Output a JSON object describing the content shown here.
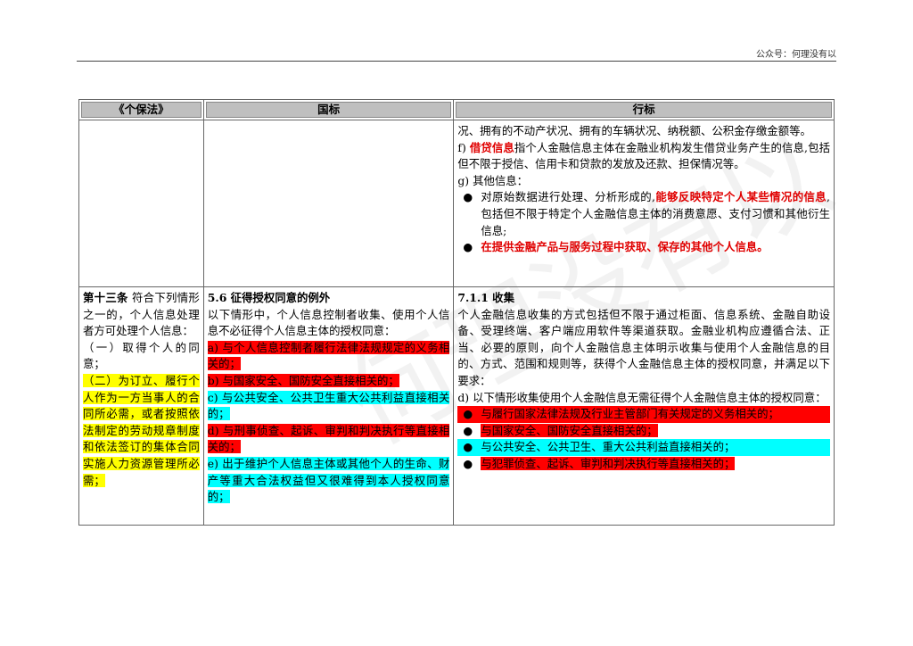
{
  "header": {
    "account": "公众号：何理没有以"
  },
  "watermark": "何理没有以",
  "table": {
    "headers": [
      "《个保法》",
      "国标",
      "行标"
    ],
    "row1": {
      "col3": {
        "cont": "况、拥有的不动产状况、拥有的车辆状况、纳税额、公积金存缴金额等。",
        "f_prefix": "f)",
        "f_term": "借贷信息",
        "f_text": "指个人金融信息主体在金融业机构发生借贷业务产生的信息,包括但不限于授信、信用卡和贷款的发放及还款、担保情况等。",
        "g": "g)  其他信息：",
        "b1_pre": "对原始数据进行处理、分析形成的,",
        "b1_red": "能够反映特定个人某些情况的信息",
        "b1_post": ",包括但不限于特定个人金融信息主体的消费意愿、支付习惯和其他衍生信息;",
        "b2_red": "在提供金融产品与服务过程中获取、保存的其他个人信息。"
      }
    },
    "row2": {
      "col1": {
        "bold": "第十三条",
        "text": " 符合下列情形之一的，个人信息处理者方可处理个人信息：",
        "item1": "（一）取得个人的同意；",
        "item2": "（二）为订立、履行个人作为一方当事人的合同所必需，或者按照依法制定的劳动规章制度和依法签订的集体合同实施人力资源管理所必需；"
      },
      "col2": {
        "title": "5.6  征得授权同意的例外",
        "intro": "以下情形中，个人信息控制者收集、使用个人信息不必征得个人信息主体的授权同意：",
        "a": "a) 与个人信息控制者履行法律法规规定的义务相关的；",
        "b": "b) 与国家安全、国防安全直接相关的；",
        "c": "c) 与公共安全、公共卫生重大公共利益直接相关的；",
        "d": "d) 与刑事侦查、起诉、审判和判决执行等直接相关的；",
        "e": "e) 出于维护个人信息主体或其他个人的生命、财产等重大合法权益但又很难得到本人授权同意的；"
      },
      "col3": {
        "title": "7.1.1  收集",
        "p1": "个人金融信息收集的方式包括但不限于通过柜面、信息系统、金融自助设备、受理终端、客户端应用软件等渠道获取。金融业机构应遵循合法、正当、必要的原则，向个人金融信息主体明示收集与使用个人金融信息的目的、方式、范围和规则等，获得个人金融信息主体的授权同意，并满足以下要求：",
        "d": "d)  以下情形收集使用个人金融信息无需征得个人金融信息主体的授权同意：",
        "b1": "与履行国家法律法规及行业主管部门有关规定的义务相关的；",
        "b2": "与国家安全、国防安全直接相关的；",
        "b3": "与公共安全、公共卫生、重大公共利益直接相关的；",
        "b4": "与犯罪侦查、起诉、审判和判决执行等直接相关的；"
      }
    }
  },
  "bullet_glyph": "●"
}
